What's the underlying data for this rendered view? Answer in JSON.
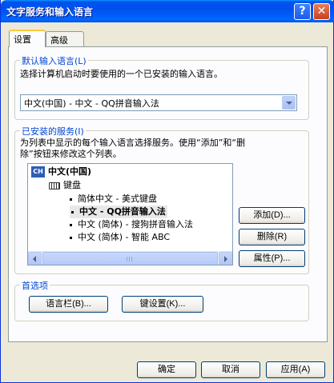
{
  "window": {
    "title": "文字服务和输入语言",
    "help_label": "?",
    "close_label": "✕"
  },
  "tabs": {
    "settings": "设置",
    "advanced": "高级"
  },
  "default_language": {
    "legend": "默认输入语言(L)",
    "description": "选择计算机启动时要使用的一个已安装的输入语言。",
    "selected_value": "中文(中国) - 中文 - QQ拼音输入法"
  },
  "installed_services": {
    "legend": "已安装的服务(I)",
    "description_line1": "为列表中显示的每个输入语言选择服务。使用“添加”和“删",
    "description_line2": "除”按钮来修改这个列表。",
    "tree": {
      "language_badge": "CH",
      "language": "中文(中国)",
      "category": "键盘",
      "services": [
        "简体中文 - 美式键盘",
        "中文 - QQ拼音输入法",
        "中文 (简体) - 搜狗拼音输入法",
        "中文 (简体) - 智能 ABC"
      ]
    },
    "buttons": {
      "add": "添加(D)...",
      "remove": "删除(R)",
      "properties": "属性(P)..."
    }
  },
  "preferences": {
    "legend": "首选项",
    "buttons": {
      "language_bar": "语言栏(B)...",
      "key_settings": "键设置(K)..."
    }
  },
  "footer": {
    "ok": "确定",
    "cancel": "取消",
    "apply": "应用(A)"
  }
}
